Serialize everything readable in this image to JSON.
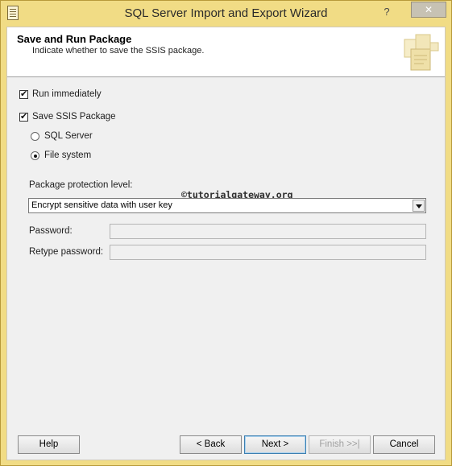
{
  "window": {
    "title": "SQL Server Import and Export Wizard",
    "close_glyph": "✕",
    "help_glyph": "?"
  },
  "header": {
    "title": "Save and Run Package",
    "subtitle": "Indicate whether to save the SSIS package."
  },
  "options": {
    "run_immediately": {
      "label": "Run immediately",
      "checked": true
    },
    "save_ssis_package": {
      "label": "Save SSIS Package",
      "checked": true
    },
    "sql_server": {
      "label": "SQL Server",
      "selected": false
    },
    "file_system": {
      "label": "File system",
      "selected": true
    }
  },
  "protection": {
    "label": "Package protection level:",
    "selected_value": "Encrypt sensitive data with user key"
  },
  "password": {
    "label": "Password:",
    "value": ""
  },
  "retype_password": {
    "label": "Retype password:",
    "value": ""
  },
  "watermark": "©tutorialgateway.org",
  "buttons": {
    "help": "Help",
    "back": "< Back",
    "next": "Next >",
    "finish": "Finish >>|",
    "cancel": "Cancel"
  },
  "colors": {
    "frame": "#f1dc85",
    "client": "#f0f0f0",
    "header_bg": "#ffffff"
  }
}
